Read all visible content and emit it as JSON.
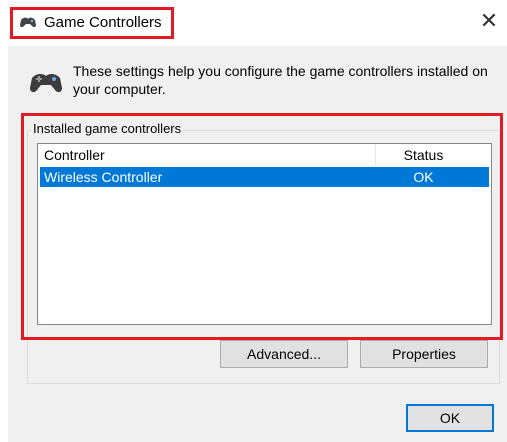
{
  "window": {
    "title": "Game Controllers",
    "close_glyph": "✕"
  },
  "intro": {
    "text": "These settings help you configure the game controllers installed on your computer."
  },
  "group": {
    "label": "Installed game controllers"
  },
  "list": {
    "columns": [
      "Controller",
      "Status"
    ],
    "rows": [
      {
        "controller": "Wireless Controller",
        "status": "OK",
        "selected": true
      }
    ]
  },
  "buttons": {
    "advanced": "Advanced...",
    "properties": "Properties",
    "ok": "OK"
  },
  "icons": {
    "title": "gamepad-icon",
    "intro": "gamepad-icon"
  },
  "colors": {
    "highlight_frame": "#e01b24",
    "selection": "#0078d7",
    "dialog_bg": "#f0f0f0"
  }
}
